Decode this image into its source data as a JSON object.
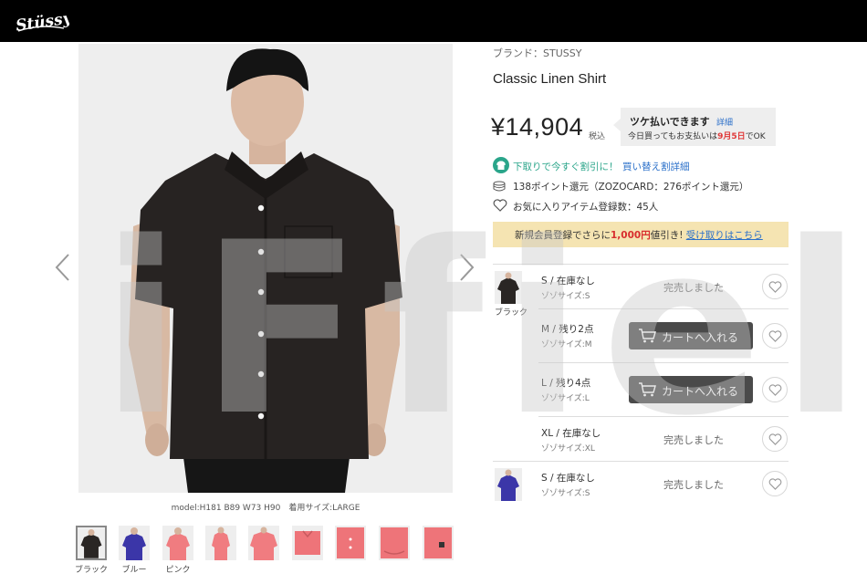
{
  "header": {
    "logo": "Stüssy"
  },
  "watermark": "iFfield",
  "product": {
    "brand": "ブランド：STUSSY",
    "title": "Classic Linen Shirt",
    "price": "¥14,904",
    "tax": "税込"
  },
  "photo": {
    "caption": "model:H181 B89 W73 H90　着用サイズ:LARGE"
  },
  "thumbnails": [
    {
      "color": "#2a2624",
      "label": "ブラック",
      "selected": true
    },
    {
      "color": "#3b36a8",
      "label": "ブルー"
    },
    {
      "color": "#f07c80",
      "label": "ピンク"
    },
    {
      "color": "#f07c80",
      "label": ""
    },
    {
      "color": "#f07c80",
      "label": ""
    },
    {
      "color": "#ee7479",
      "label": ""
    },
    {
      "color": "#ee7479",
      "label": ""
    },
    {
      "color": "#ee7479",
      "label": ""
    },
    {
      "color": "#ee7479",
      "label": ""
    }
  ],
  "tsuke": {
    "main": "ツケ払いできます",
    "detail": "詳細",
    "sub_pre": "今日買ってもお支払いは",
    "sub_date": "9月5日",
    "sub_post": "でOK"
  },
  "trade": {
    "text": "下取りで今すぐ割引に！",
    "link": "買い替え割詳細"
  },
  "points": {
    "text": "138ポイント還元（ZOZOCARD：276ポイント還元）"
  },
  "favorites": {
    "text": "お気に入りアイテム登録数：45人"
  },
  "banner": {
    "pre": "新規会員登録でさらに",
    "highlight": "1,000円",
    "mid": "値引き! ",
    "link": "受け取りはこちら"
  },
  "stock": {
    "cart_label": "カートへ入れる",
    "sold_label": "完売しました",
    "colors": [
      {
        "name": "ブラック",
        "swatch": "#2a2624"
      },
      {
        "name": "",
        "swatch": "#3b36a8"
      }
    ],
    "rows": [
      {
        "size": "S / 在庫なし",
        "zozo": "ゾゾサイズ:S"
      },
      {
        "size": "M / 残り2点",
        "zozo": "ゾゾサイズ:M"
      },
      {
        "size": "L / 残り4点",
        "zozo": "ゾゾサイズ:L"
      },
      {
        "size": "XL / 在庫なし",
        "zozo": "ゾゾサイズ:XL"
      },
      {
        "size": "S / 在庫なし",
        "zozo": "ゾゾサイズ:S"
      }
    ]
  },
  "colors": {
    "header_bg": "#000000",
    "accent_link": "#2a6fc9",
    "trade_green": "#2aa58a",
    "sale_red": "#d82e2e",
    "banner_bg": "#f5e4b2",
    "cart_button_bg": "#4a4a4a"
  }
}
